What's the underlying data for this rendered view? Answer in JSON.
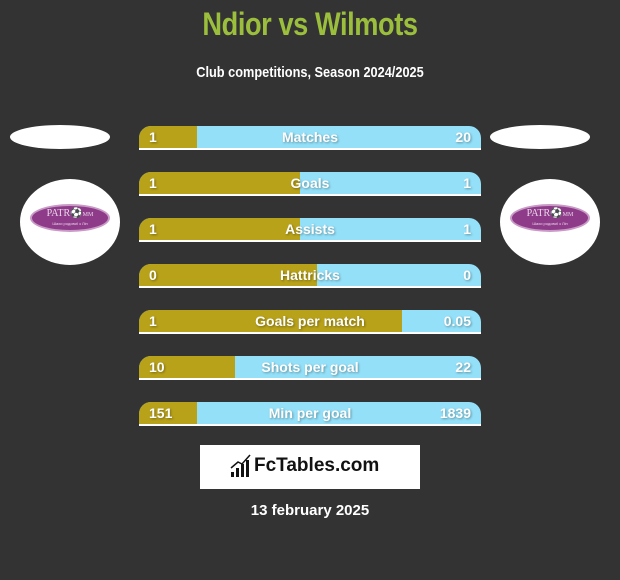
{
  "header": {
    "title": "Ndior vs Wilmots",
    "subtitle": "Club competitions, Season 2024/2025"
  },
  "teams": {
    "left": {
      "logo_text": "PATR",
      "logo_sub": "MM",
      "logo_tagline": "Шахи родовиї з Ліп"
    },
    "right": {
      "logo_text": "PATR",
      "logo_sub": "MM",
      "logo_tagline": "Шахи родовиї з Ліп"
    }
  },
  "colors": {
    "left": "#b8a21a",
    "right": "#94e0f8",
    "title": "#9bbf3d",
    "background": "#333333"
  },
  "stats": [
    {
      "label": "Matches",
      "left": "1",
      "right": "20",
      "left_share": 0.17
    },
    {
      "label": "Goals",
      "left": "1",
      "right": "1",
      "left_share": 0.47
    },
    {
      "label": "Assists",
      "left": "1",
      "right": "1",
      "left_share": 0.47
    },
    {
      "label": "Hattricks",
      "left": "0",
      "right": "0",
      "left_share": 0.52
    },
    {
      "label": "Goals per match",
      "left": "1",
      "right": "0.05",
      "left_share": 0.77
    },
    {
      "label": "Shots per goal",
      "left": "10",
      "right": "22",
      "left_share": 0.28
    },
    {
      "label": "Min per goal",
      "left": "151",
      "right": "1839",
      "left_share": 0.17
    }
  ],
  "footer": {
    "brand": "FcTables.com",
    "date": "13 february 2025"
  }
}
